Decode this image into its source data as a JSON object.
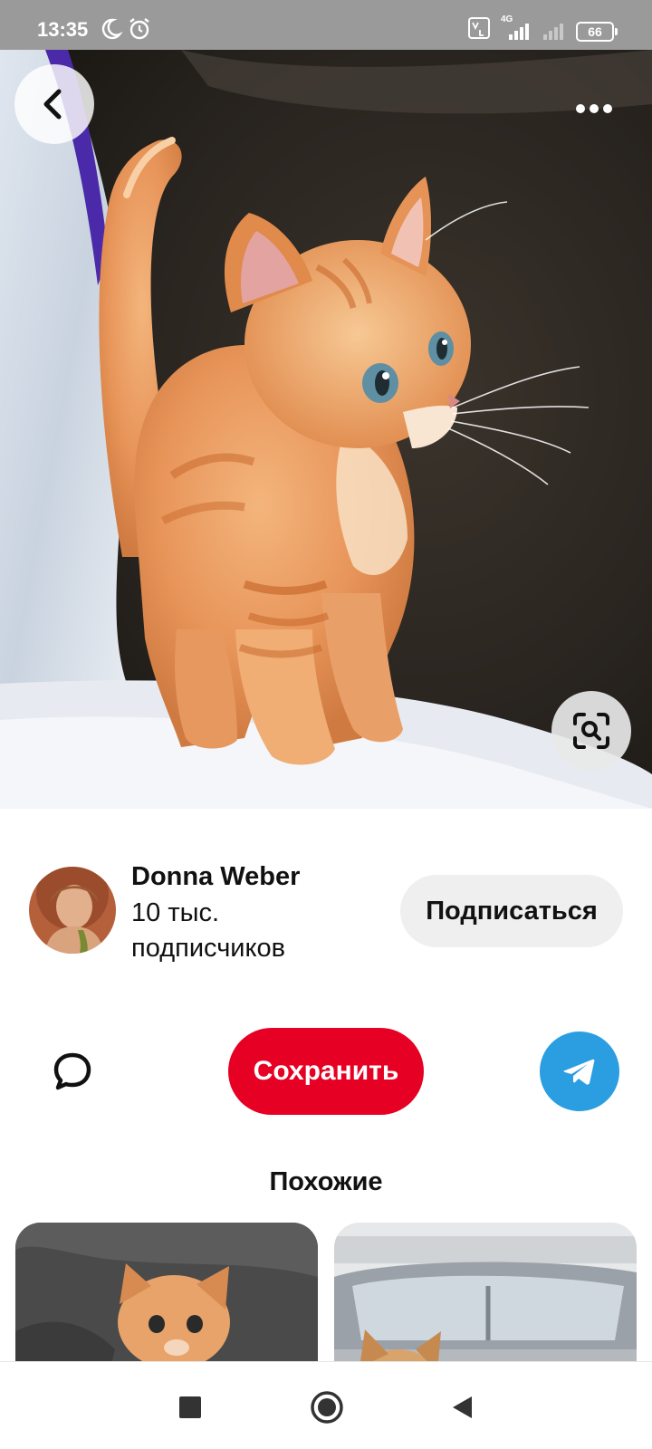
{
  "status_bar": {
    "time": "13:35",
    "network": "4G",
    "battery": "66",
    "icons": [
      "moon-icon",
      "alarm-icon",
      "volte-icon",
      "signal-icon",
      "signal-weak-icon",
      "battery-icon"
    ]
  },
  "hero": {
    "subject": "ginger kitten photo",
    "back_icon": "chevron-left-icon",
    "more_icon": "more-dots-icon",
    "lens_icon": "visual-search-icon"
  },
  "creator": {
    "name": "Donna Weber",
    "followers": "10 тыс. подписчиков",
    "follow_label": "Подписаться"
  },
  "actions": {
    "comment_icon": "comment-icon",
    "save_label": "Сохранить",
    "share_icon": "telegram-icon"
  },
  "similar": {
    "title": "Похожие"
  },
  "nav": {
    "icons": [
      "recents-square-icon",
      "home-circle-icon",
      "back-triangle-icon"
    ]
  },
  "colors": {
    "accent": "#e60023",
    "telegram": "#2a9ee0",
    "status_bar": "#9a9a9a"
  }
}
